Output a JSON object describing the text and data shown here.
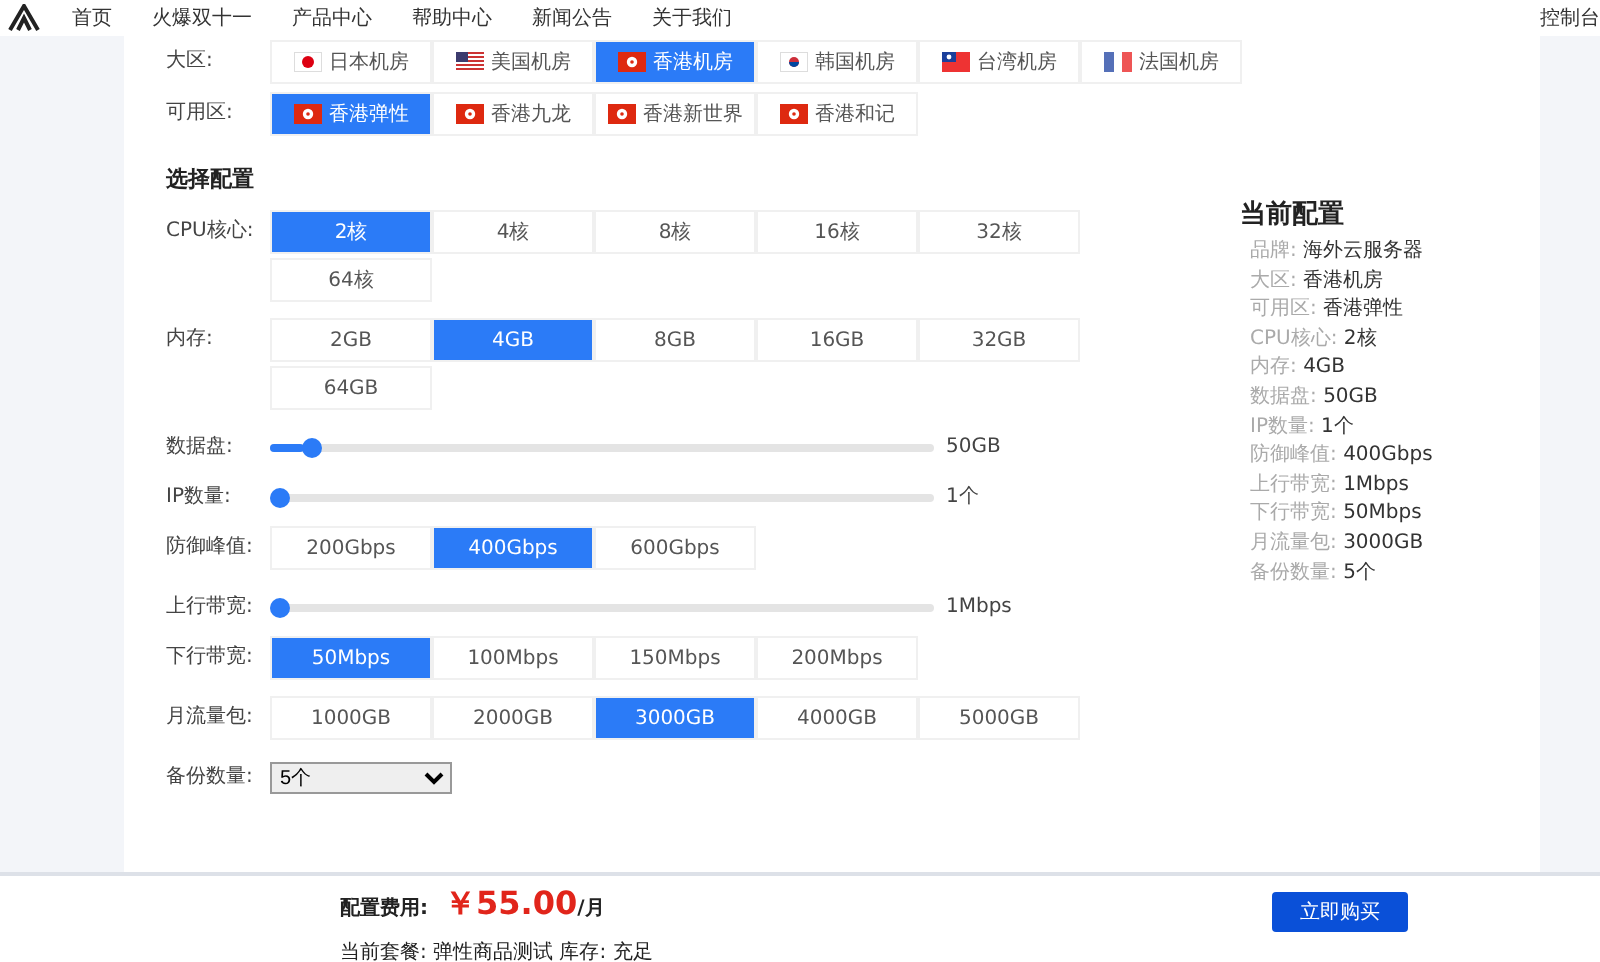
{
  "nav": {
    "items": [
      "首页",
      "火爆双十一",
      "产品中心",
      "帮助中心",
      "新闻公告",
      "关于我们"
    ],
    "right": "控制台"
  },
  "regions": {
    "label": "大区:",
    "options": [
      {
        "label": "日本机房",
        "kind": "jp",
        "selected": false
      },
      {
        "label": "美国机房",
        "kind": "us",
        "selected": false
      },
      {
        "label": "香港机房",
        "kind": "hk",
        "selected": true
      },
      {
        "label": "韩国机房",
        "kind": "kr",
        "selected": false
      },
      {
        "label": "台湾机房",
        "kind": "tw",
        "selected": false
      },
      {
        "label": "法国机房",
        "kind": "fr",
        "selected": false
      }
    ]
  },
  "zones": {
    "label": "可用区:",
    "options": [
      {
        "label": "香港弹性",
        "kind": "hk",
        "selected": true
      },
      {
        "label": "香港九龙",
        "kind": "hk",
        "selected": false
      },
      {
        "label": "香港新世界",
        "kind": "hk",
        "selected": false
      },
      {
        "label": "香港和记",
        "kind": "hk",
        "selected": false
      }
    ]
  },
  "config": {
    "title": "选择配置",
    "rows": [
      {
        "kind": "options",
        "label": "CPU核心:",
        "options": [
          {
            "label": "2核",
            "selected": true
          },
          {
            "label": "4核",
            "selected": false
          },
          {
            "label": "8核",
            "selected": false
          },
          {
            "label": "16核",
            "selected": false
          },
          {
            "label": "32核",
            "selected": false
          },
          {
            "label": "64核",
            "selected": false
          }
        ]
      },
      {
        "kind": "options",
        "label": "内存:",
        "options": [
          {
            "label": "2GB",
            "selected": false
          },
          {
            "label": "4GB",
            "selected": true
          },
          {
            "label": "8GB",
            "selected": false
          },
          {
            "label": "16GB",
            "selected": false
          },
          {
            "label": "32GB",
            "selected": false
          },
          {
            "label": "64GB",
            "selected": false
          }
        ]
      },
      {
        "kind": "slider",
        "label": "数据盘:",
        "level": 0.05,
        "reading": "50GB"
      },
      {
        "kind": "slider",
        "label": "IP数量:",
        "level": 0,
        "reading": "1个"
      },
      {
        "kind": "options",
        "label": "防御峰值:",
        "options": [
          {
            "label": "200Gbps",
            "selected": false
          },
          {
            "label": "400Gbps",
            "selected": true
          },
          {
            "label": "600Gbps",
            "selected": false
          }
        ]
      },
      {
        "kind": "slider",
        "label": "上行带宽:",
        "level": 0,
        "reading": "1Mbps"
      },
      {
        "kind": "options",
        "label": "下行带宽:",
        "options": [
          {
            "label": "50Mbps",
            "selected": true
          },
          {
            "label": "100Mbps",
            "selected": false
          },
          {
            "label": "150Mbps",
            "selected": false
          },
          {
            "label": "200Mbps",
            "selected": false
          }
        ]
      },
      {
        "kind": "options",
        "label": "月流量包:",
        "options": [
          {
            "label": "1000GB",
            "selected": false
          },
          {
            "label": "2000GB",
            "selected": false
          },
          {
            "label": "3000GB",
            "selected": true
          },
          {
            "label": "4000GB",
            "selected": false
          },
          {
            "label": "5000GB",
            "selected": false
          }
        ]
      },
      {
        "kind": "select",
        "label": "备份数量:",
        "value": "5个"
      }
    ]
  },
  "summary": {
    "title": "当前配置",
    "items": [
      {
        "label": "品牌:",
        "value": "海外云服务器"
      },
      {
        "label": "大区:",
        "value": "香港机房"
      },
      {
        "label": "可用区:",
        "value": "香港弹性"
      },
      {
        "label": "CPU核心:",
        "value": "2核"
      },
      {
        "label": "内存:",
        "value": "4GB"
      },
      {
        "label": "数据盘:",
        "value": "50GB"
      },
      {
        "label": "IP数量:",
        "value": "1个"
      },
      {
        "label": "防御峰值:",
        "value": "400Gbps"
      },
      {
        "label": "上行带宽:",
        "value": "1Mbps"
      },
      {
        "label": "下行带宽:",
        "value": "50Mbps"
      },
      {
        "label": "月流量包:",
        "value": "3000GB"
      },
      {
        "label": "备份数量:",
        "value": "5个"
      }
    ]
  },
  "footer": {
    "price_label": "配置费用:",
    "price": "￥55.00",
    "unit": "/月",
    "package": "当前套餐: 弹性商品测试 库存: 充足",
    "buy": "立即购买"
  }
}
